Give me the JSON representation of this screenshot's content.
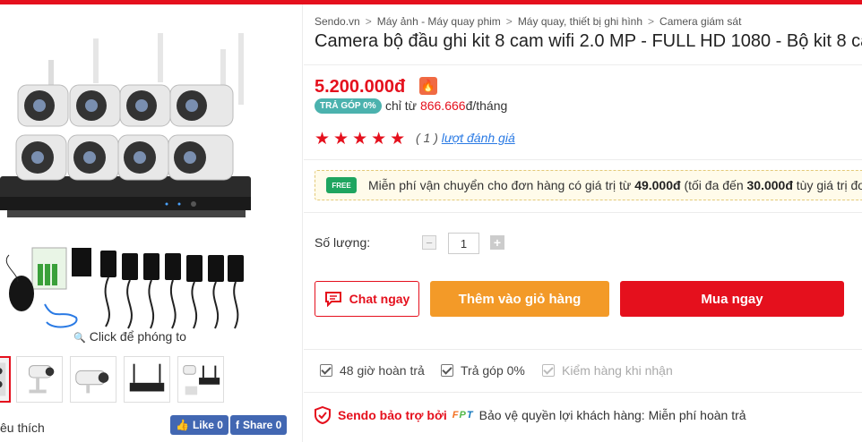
{
  "colors": {
    "accent": "#e5101d",
    "cart": "#f39a28",
    "installment_badge": "#4bb2ae",
    "facebook": "#4267b2",
    "free_ship": "#1fa55f"
  },
  "gallery": {
    "zoom_hint": "Click để phóng to",
    "favorite_label": "êu thích",
    "like_button": "Like 0",
    "share_button": "Share 0",
    "thumbnails": [
      "camera-kit",
      "bullet-camera",
      "bullet-camera-2",
      "nvr-with-antennas",
      "camera-set-box"
    ]
  },
  "breadcrumb": [
    "Sendo.vn",
    "Máy ảnh - Máy quay phim",
    "Máy quay, thiết bị ghi hình",
    "Camera giám sát"
  ],
  "product": {
    "title": "Camera bộ đầu ghi kit 8 cam wifi 2.0 MP - FULL HD 1080 - Bộ kit 8 ca",
    "price": "5.200.000đ",
    "installment_badge": "TRẢ GÓP 0%",
    "installment_prefix": "chỉ từ",
    "installment_amount": "866.666",
    "installment_suffix": "đ/tháng",
    "rating_stars": 5,
    "rating_stars_text": "★★★★★",
    "rating_count": "( 1 )",
    "rating_link": "lượt đánh giá"
  },
  "shipping": {
    "badge": "FREE",
    "text_1": "Miễn phí vận chuyển cho đơn hàng có giá trị từ",
    "min_value": "49.000đ",
    "text_2": "(tối đa đến",
    "max_value": "30.000đ",
    "text_3": "tùy giá trị đơ"
  },
  "quantity": {
    "label": "Số lượng:",
    "value": "1",
    "minus": "−",
    "plus": "+"
  },
  "actions": {
    "chat": "Chat ngay",
    "add_to_cart": "Thêm vào giỏ hàng",
    "buy_now": "Mua ngay"
  },
  "policies": [
    {
      "label": "48 giờ hoàn trả",
      "enabled": true
    },
    {
      "label": "Trả góp 0%",
      "enabled": true
    },
    {
      "label": "Kiểm hàng khi nhận",
      "enabled": false
    }
  ],
  "guarantee": {
    "brand": "Sendo bảo trợ bởi",
    "partner": "FPT",
    "text": "Bảo vệ quyền lợi khách hàng: Miễn phí hoàn trả"
  }
}
